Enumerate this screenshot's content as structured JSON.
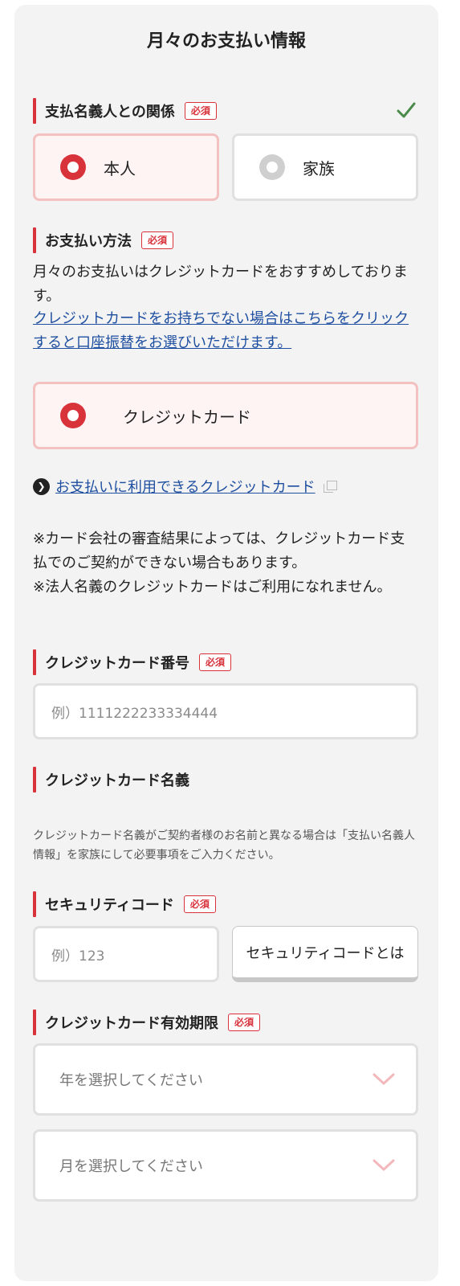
{
  "title": "月々のお支払い情報",
  "relationship": {
    "label": "支払名義人との関係",
    "required": "必須",
    "options": [
      {
        "label": "本人",
        "selected": true
      },
      {
        "label": "家族",
        "selected": false
      }
    ],
    "icon": "check-icon"
  },
  "payment_method": {
    "label": "お支払い方法",
    "required": "必須",
    "description": "月々のお支払いはクレジットカードをおすすめしております。",
    "link": "クレジットカードをお持ちでない場合はこちらをクリックすると口座振替をお選びいただけます。",
    "option": {
      "label": "クレジットカード",
      "selected": true
    },
    "card_link": "お支払いに利用できるクレジットカード",
    "notes": [
      "※カード会社の審査結果によっては、クレジットカード支払でのご契約ができない場合もあります。",
      "※法人名義のクレジットカードはご利用になれません。"
    ]
  },
  "card_number": {
    "label": "クレジットカード番号",
    "required": "必須",
    "placeholder": "例）1111222233334444"
  },
  "card_name": {
    "label": "クレジットカード名義",
    "note": "クレジットカード名義がご契約者様のお名前と異なる場合は「支払い名義人情報」を家族にして必要事項をご入力ください。"
  },
  "security_code": {
    "label": "セキュリティコード",
    "required": "必須",
    "placeholder": "例）123",
    "button": "セキュリティコードとは"
  },
  "expiry": {
    "label": "クレジットカード有効期限",
    "required": "必須",
    "year_placeholder": "年を選択してください",
    "month_placeholder": "月を選択してください"
  },
  "colors": {
    "accent": "#d8323b",
    "selected_bg": "#fdf4f3",
    "selected_border": "#f4c1c1",
    "link": "#1f4fa0",
    "check": "#4a8a4a"
  }
}
